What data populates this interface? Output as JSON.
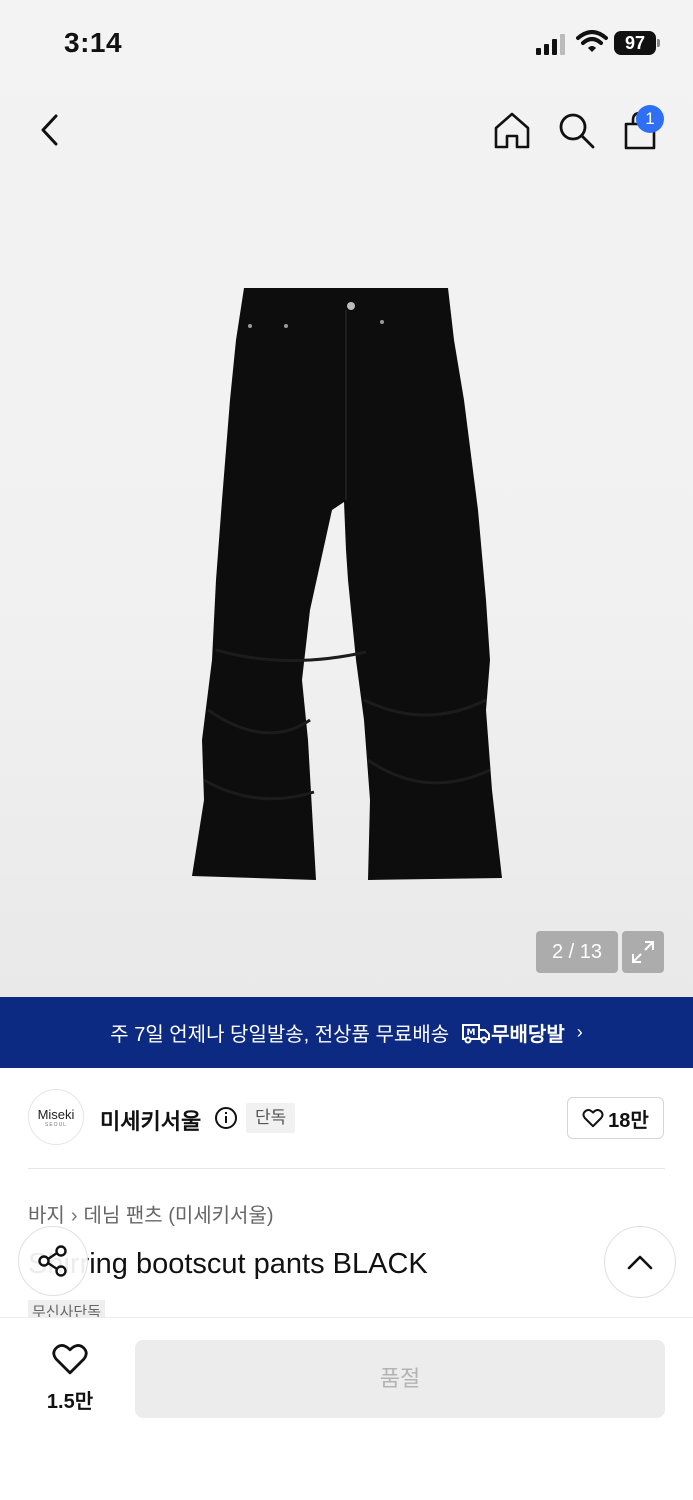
{
  "status_bar": {
    "time": "3:14",
    "battery": "97"
  },
  "nav": {
    "cart_count": "1"
  },
  "gallery": {
    "counter": "2 / 13"
  },
  "banner": {
    "text": "주 7일 언제나 당일발송, 전상품 무료배송",
    "logo_text": "무배당발",
    "chevron": "›"
  },
  "brand": {
    "logo_name": "Miseki",
    "logo_sub": "SEOUL",
    "name": "미세키서울",
    "tag": "단독",
    "likes": "18만"
  },
  "breadcrumb": {
    "category": "바지",
    "separator": "›",
    "subcategory": "데님 팬츠 (미세키서울)"
  },
  "product": {
    "title": "Shirring bootscut pants BLACK",
    "badge": "무신사단독"
  },
  "bottom_bar": {
    "fav_count": "1.5만",
    "soldout_label": "품절"
  },
  "colors": {
    "banner_bg": "#0c2a82",
    "badge_blue": "#2f6ff6",
    "soldout_bg": "#ececec"
  }
}
